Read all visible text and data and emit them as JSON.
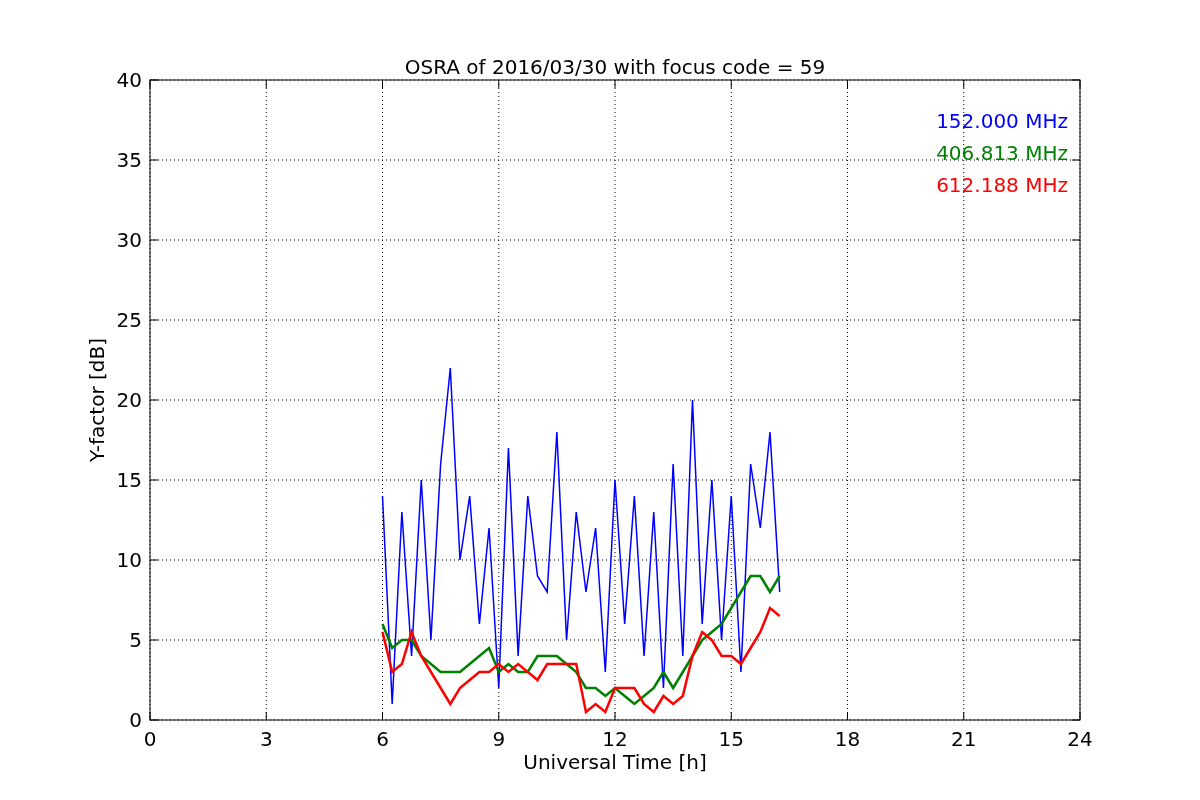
{
  "figure": {
    "chart_data": {
      "type": "line",
      "title": "OSRA of 2016/03/30 with focus code = 59",
      "xlabel": "Universal Time [h]",
      "ylabel": "Y-factor [dB]",
      "x": [
        6,
        6.25,
        6.5,
        6.75,
        7,
        7.25,
        7.5,
        7.75,
        8,
        8.25,
        8.5,
        8.75,
        9,
        9.25,
        9.5,
        9.75,
        10,
        10.25,
        10.5,
        10.75,
        11,
        11.25,
        11.5,
        11.75,
        12,
        12.25,
        12.5,
        12.75,
        13,
        13.25,
        13.5,
        13.75,
        14,
        14.25,
        14.5,
        14.75,
        15,
        15.25,
        15.5,
        15.75,
        16,
        16.25
      ],
      "series": [
        {
          "name": "152.000 MHz",
          "color": "#0000ff",
          "values": [
            14,
            1,
            13,
            4,
            15,
            5,
            16,
            22,
            10,
            14,
            6,
            12,
            2,
            17,
            4,
            14,
            9,
            8,
            18,
            5,
            13,
            8,
            12,
            3,
            15,
            6,
            14,
            4,
            13,
            2,
            16,
            4,
            20,
            6,
            15,
            5,
            14,
            3,
            16,
            12,
            18,
            8
          ]
        },
        {
          "name": "406.813 MHz",
          "color": "#008000",
          "values": [
            6,
            4.5,
            5,
            5,
            4,
            3.5,
            3,
            3,
            3,
            3.5,
            4,
            4.5,
            3,
            3.5,
            3,
            3,
            4,
            4,
            4,
            3.5,
            3,
            2,
            2,
            1.5,
            2,
            1.5,
            1,
            1.5,
            2,
            3,
            2,
            3,
            4,
            5,
            5.5,
            6,
            7,
            8,
            9,
            9,
            8,
            9
          ]
        },
        {
          "name": "612.188 MHz",
          "color": "#ff0000",
          "values": [
            5.5,
            3,
            3.5,
            5.5,
            4,
            3,
            2,
            1,
            2,
            2.5,
            3,
            3,
            3.5,
            3,
            3.5,
            3,
            2.5,
            3.5,
            3.5,
            3.5,
            3.5,
            0.5,
            1,
            0.5,
            2,
            2,
            2,
            1,
            0.5,
            1.5,
            1,
            1.5,
            4,
            5.5,
            5,
            4,
            4,
            3.5,
            4.5,
            5.5,
            7,
            6.5
          ]
        }
      ],
      "grid": true,
      "xlim": [
        0,
        24
      ],
      "ylim": [
        0,
        40
      ],
      "xticks": [
        0,
        3,
        6,
        9,
        12,
        15,
        18,
        21,
        24
      ],
      "yticks": [
        0,
        5,
        10,
        15,
        20,
        25,
        30,
        35,
        40
      ]
    }
  }
}
